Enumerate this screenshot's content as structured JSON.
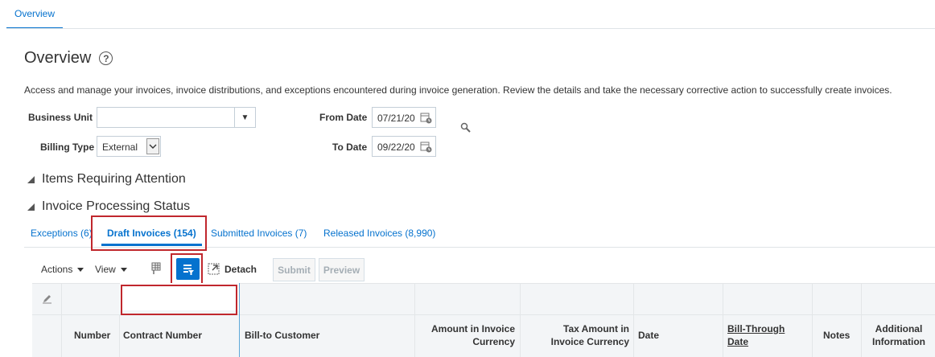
{
  "top_tab": "Overview",
  "page": {
    "title": "Overview",
    "help_symbol": "?",
    "description": "Access and manage your invoices, invoice distributions, and exceptions encountered during invoice generation. Review the details and take the necessary corrective action to successfully create invoices."
  },
  "filters": {
    "business_unit_label": "Business Unit",
    "business_unit_value": "",
    "billing_type_label": "Billing Type",
    "billing_type_value": "External",
    "from_date_label": "From Date",
    "from_date_value": "07/21/20",
    "to_date_label": "To Date",
    "to_date_value": "09/22/20"
  },
  "sections": {
    "items_requiring_attention": "Items Requiring Attention",
    "invoice_processing_status": "Invoice Processing Status"
  },
  "tabs": [
    {
      "label": "Exceptions (6)"
    },
    {
      "label": "Draft Invoices (154)"
    },
    {
      "label": "Submitted Invoices (7)"
    },
    {
      "label": "Released Invoices (8,990)"
    }
  ],
  "toolbar": {
    "actions": "Actions",
    "view": "View",
    "detach": "Detach",
    "submit": "Submit",
    "preview": "Preview"
  },
  "table": {
    "columns": [
      "Number",
      "Contract Number",
      "Bill-to Customer",
      "Amount in Invoice",
      "Currency",
      "Tax Amount in",
      "Invoice Currency",
      "Date",
      "Bill-Through",
      "Date",
      "Notes",
      "Additional",
      "Information"
    ]
  },
  "colors": {
    "accent": "#0572ce",
    "highlight": "#c0272d"
  }
}
